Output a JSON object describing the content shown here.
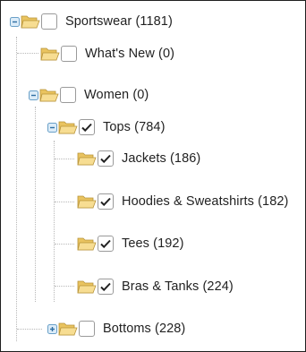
{
  "tree": {
    "nodes": [
      {
        "id": "sportswear",
        "label": "Sportswear (1181)",
        "toggle": "collapse",
        "checked": false
      },
      {
        "id": "whats-new",
        "label": "What's New (0)",
        "toggle": "none",
        "checked": false
      },
      {
        "id": "women",
        "label": "Women (0)",
        "toggle": "collapse",
        "checked": false
      },
      {
        "id": "tops",
        "label": "Tops (784)",
        "toggle": "collapse",
        "checked": true
      },
      {
        "id": "jackets",
        "label": "Jackets (186)",
        "toggle": "none",
        "checked": true
      },
      {
        "id": "hoodies",
        "label": "Hoodies & Sweatshirts (182)",
        "toggle": "none",
        "checked": true
      },
      {
        "id": "tees",
        "label": "Tees (192)",
        "toggle": "none",
        "checked": true
      },
      {
        "id": "bras-tanks",
        "label": "Bras & Tanks (224)",
        "toggle": "none",
        "checked": true
      },
      {
        "id": "bottoms",
        "label": "Bottoms (228)",
        "toggle": "expand",
        "checked": false
      }
    ]
  },
  "colors": {
    "border": "#1f1f1f",
    "checkbox_border": "#9a9a9a",
    "toggle_blue": "#6aa0c8",
    "folder_yellow": "#f3d27a"
  }
}
